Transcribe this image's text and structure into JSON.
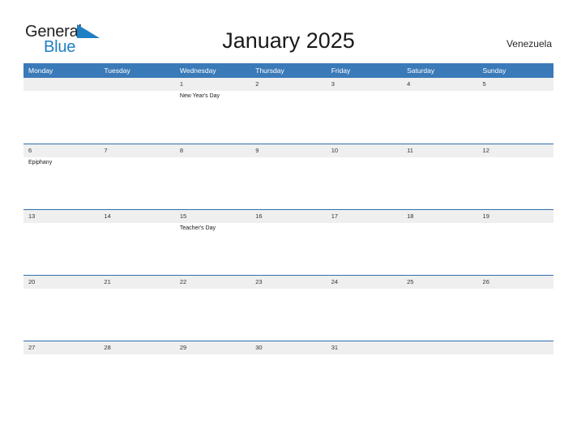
{
  "logo": {
    "word_one": "General",
    "word_two": "Blue",
    "flag_icon": "blue-flag-triangle",
    "brand_blue": "#1e7fc4",
    "brand_dark": "#231f20"
  },
  "header": {
    "title": "January 2025",
    "country": "Venezuela"
  },
  "colors": {
    "header_blue": "#3a7ab8",
    "row_line_blue": "#2f6fae",
    "band_gray": "#efefef",
    "text_dark": "#333333"
  },
  "calendar": {
    "weekdays": [
      "Monday",
      "Tuesday",
      "Wednesday",
      "Thursday",
      "Friday",
      "Saturday",
      "Sunday"
    ],
    "weeks": [
      [
        {
          "day": "",
          "event": ""
        },
        {
          "day": "",
          "event": ""
        },
        {
          "day": "1",
          "event": "New Year's Day"
        },
        {
          "day": "2",
          "event": ""
        },
        {
          "day": "3",
          "event": ""
        },
        {
          "day": "4",
          "event": ""
        },
        {
          "day": "5",
          "event": ""
        }
      ],
      [
        {
          "day": "6",
          "event": "Epiphany"
        },
        {
          "day": "7",
          "event": ""
        },
        {
          "day": "8",
          "event": ""
        },
        {
          "day": "9",
          "event": ""
        },
        {
          "day": "10",
          "event": ""
        },
        {
          "day": "11",
          "event": ""
        },
        {
          "day": "12",
          "event": ""
        }
      ],
      [
        {
          "day": "13",
          "event": ""
        },
        {
          "day": "14",
          "event": ""
        },
        {
          "day": "15",
          "event": "Teacher's Day"
        },
        {
          "day": "16",
          "event": ""
        },
        {
          "day": "17",
          "event": ""
        },
        {
          "day": "18",
          "event": ""
        },
        {
          "day": "19",
          "event": ""
        }
      ],
      [
        {
          "day": "20",
          "event": ""
        },
        {
          "day": "21",
          "event": ""
        },
        {
          "day": "22",
          "event": ""
        },
        {
          "day": "23",
          "event": ""
        },
        {
          "day": "24",
          "event": ""
        },
        {
          "day": "25",
          "event": ""
        },
        {
          "day": "26",
          "event": ""
        }
      ],
      [
        {
          "day": "27",
          "event": ""
        },
        {
          "day": "28",
          "event": ""
        },
        {
          "day": "29",
          "event": ""
        },
        {
          "day": "30",
          "event": ""
        },
        {
          "day": "31",
          "event": ""
        },
        {
          "day": "",
          "event": ""
        },
        {
          "day": "",
          "event": ""
        }
      ]
    ]
  }
}
